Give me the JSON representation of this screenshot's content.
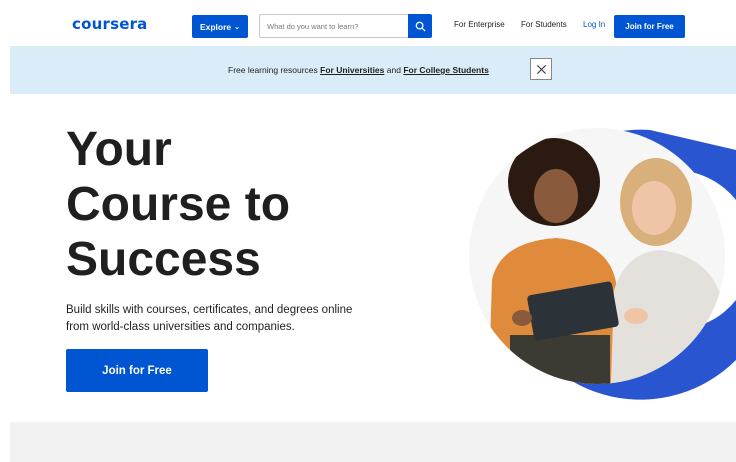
{
  "header": {
    "logo": "coursera",
    "explore_label": "Explore",
    "search_placeholder": "What do you want to learn?",
    "nav": {
      "enterprise": "For Enterprise",
      "students": "For Students",
      "login": "Log In",
      "join": "Join for Free"
    }
  },
  "banner": {
    "prefix": "Free learning resources",
    "link_universities": "For Universities",
    "conjunction": "and",
    "link_college": "For College Students"
  },
  "hero": {
    "title_lines": [
      "Your",
      "Course to",
      "Success"
    ],
    "subtitle": "Build skills with courses, certificates, and degrees online from world-class universities and companies.",
    "cta": "Join for Free"
  },
  "colors": {
    "brand_blue": "#0056d2",
    "banner_bg": "#d9ecf7"
  },
  "icons": {
    "search": "search-icon",
    "close": "close-icon",
    "explore_chevron": "chevron-down-icon"
  }
}
